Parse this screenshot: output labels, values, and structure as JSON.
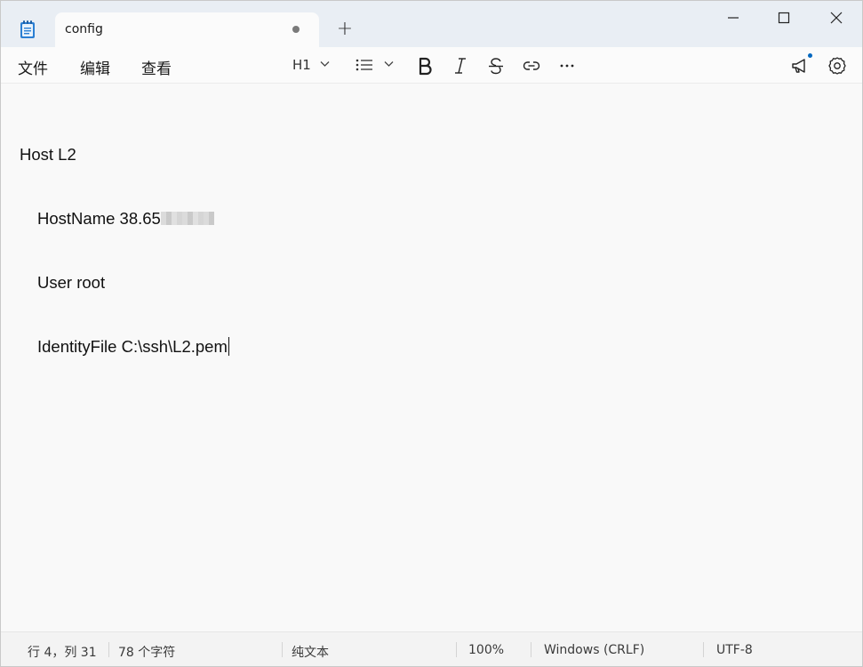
{
  "window": {
    "tab_title": "config",
    "new_tab_symbol": "+"
  },
  "menu": {
    "file": "文件",
    "edit": "编辑",
    "view": "查看"
  },
  "toolbar": {
    "heading": "H1",
    "icons": [
      "list-icon",
      "bold-icon",
      "italic-icon",
      "strikethrough-icon",
      "link-icon",
      "more-icon",
      "megaphone-icon",
      "gear-icon"
    ]
  },
  "editor": {
    "lines": [
      "Host L2",
      "HostName 38.65",
      "User root",
      "IdentityFile C:\\ssh\\L2.pem"
    ]
  },
  "status": {
    "position": "行 4，列 31",
    "char_count": "78 个字符",
    "format": "纯文本",
    "zoom": "100%",
    "line_ending": "Windows (CRLF)",
    "encoding": "UTF-8"
  },
  "colors": {
    "accent": "#0067c0",
    "titlebar": "#e9eef4",
    "editor_bg": "#f9f9f9"
  }
}
